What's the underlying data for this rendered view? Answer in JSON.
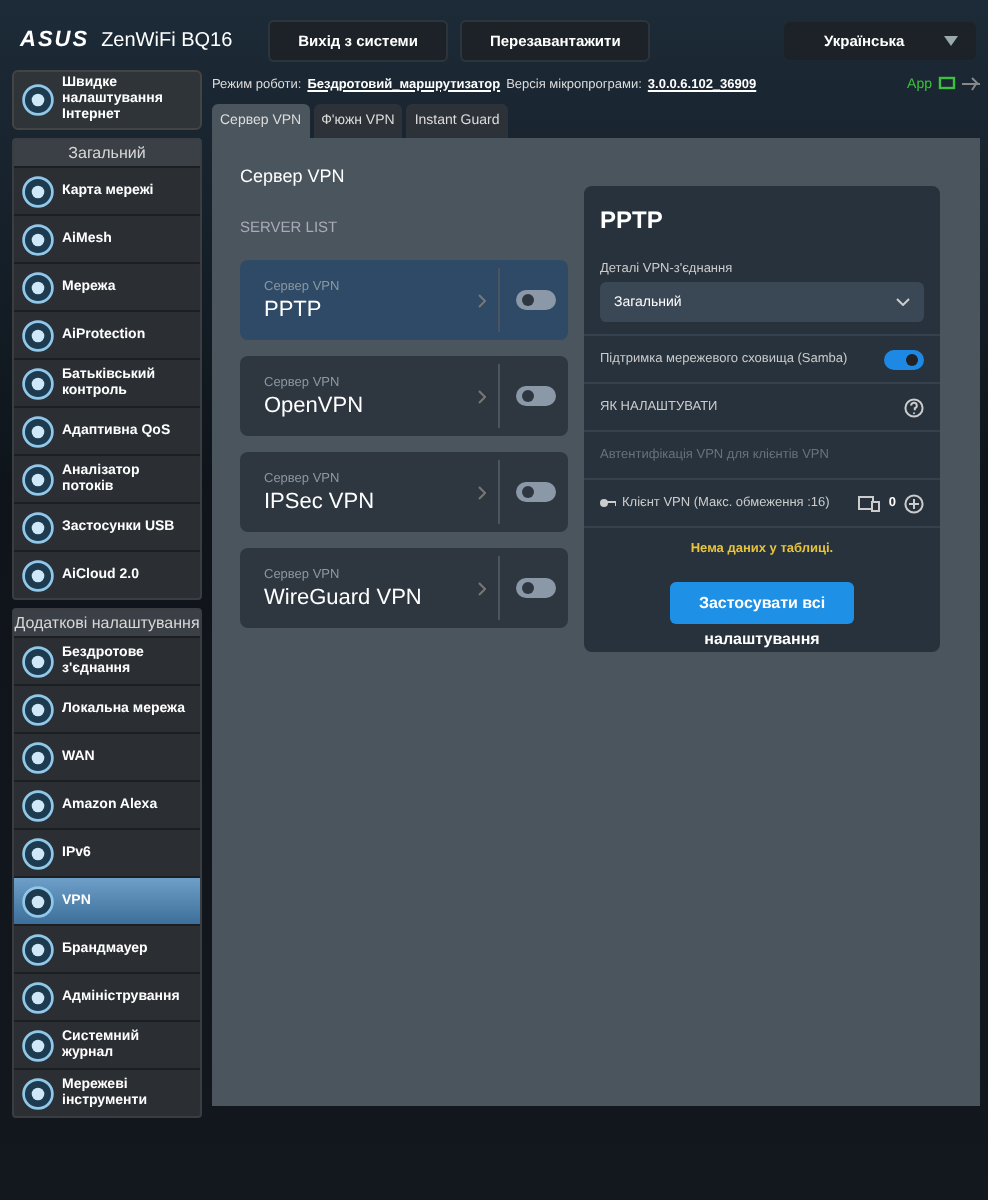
{
  "header": {
    "logo": "ASUS",
    "model": "ZenWiFi BQ16",
    "buttons": [
      "Вихід з системи",
      "Перезавантажити"
    ],
    "language": "Українська"
  },
  "quick_setup": {
    "label": "Швидке налаштування Інтернет"
  },
  "status": {
    "mode_label": "Режим роботи:",
    "mode": "Бездротовий_маршрутизатор",
    "firmware_label": "Версія мікропрограми:",
    "firmware": "3.0.0.6.102_36909",
    "app": "App"
  },
  "sidebar": {
    "sections": [
      {
        "title": "Загальний",
        "items": [
          {
            "label": "Карта мережі",
            "selected": false
          },
          {
            "label": "AiMesh",
            "selected": false
          },
          {
            "label": "Мережа",
            "selected": false
          },
          {
            "label": "AiProtection",
            "selected": false
          },
          {
            "label": "Батьківський контроль",
            "selected": false
          },
          {
            "label": "Адаптивна QoS",
            "selected": false
          },
          {
            "label": "Аналізатор потоків",
            "selected": false
          },
          {
            "label": "Застосунки USB",
            "selected": false
          },
          {
            "label": "AiCloud 2.0",
            "selected": false
          }
        ]
      },
      {
        "title": "Додаткові налаштування",
        "items": [
          {
            "label": "Бездротове з'єднання",
            "selected": false
          },
          {
            "label": "Локальна мережа",
            "selected": false
          },
          {
            "label": "WAN",
            "selected": false
          },
          {
            "label": "Amazon Alexa",
            "selected": false
          },
          {
            "label": "IPv6",
            "selected": false
          },
          {
            "label": "VPN",
            "selected": true
          },
          {
            "label": "Брандмауер",
            "selected": false
          },
          {
            "label": "Адміністрування",
            "selected": false
          },
          {
            "label": "Системний журнал",
            "selected": false
          },
          {
            "label": "Мережеві інструменти",
            "selected": false
          }
        ]
      }
    ]
  },
  "tabs": [
    {
      "label": "Сервер VPN",
      "selected": true
    },
    {
      "label": "Ф'южн VPN",
      "selected": false
    },
    {
      "label": "Instant Guard",
      "selected": false
    }
  ],
  "panel": {
    "title": "Сервер VPN",
    "list_title": "SERVER LIST",
    "servers": [
      {
        "caption": "Сервер VPN",
        "name": "PPTP",
        "selected": true,
        "on": false
      },
      {
        "caption": "Сервер VPN",
        "name": "OpenVPN",
        "selected": false,
        "on": false
      },
      {
        "caption": "Сервер VPN",
        "name": "IPSec VPN",
        "selected": false,
        "on": false
      },
      {
        "caption": "Сервер VPN",
        "name": "WireGuard VPN",
        "selected": false,
        "on": false
      }
    ]
  },
  "details": {
    "title": "PPTP",
    "detail_label": "Деталі VPN-з'єднання",
    "detail_value": "Загальний",
    "samba": {
      "label": "Підтримка мережевого сховища (Samba)",
      "on": true
    },
    "howto": "ЯК НАЛАШТУВАТИ",
    "auth": "Автентифікація VPN для клієнтів VPN",
    "clients": {
      "label": "Клієнт VPN (Макс. обмеження :16)",
      "count": "0"
    },
    "empty": "Нема даних у таблиці.",
    "apply": "Застосувати всі",
    "apply_below": "налаштування"
  }
}
